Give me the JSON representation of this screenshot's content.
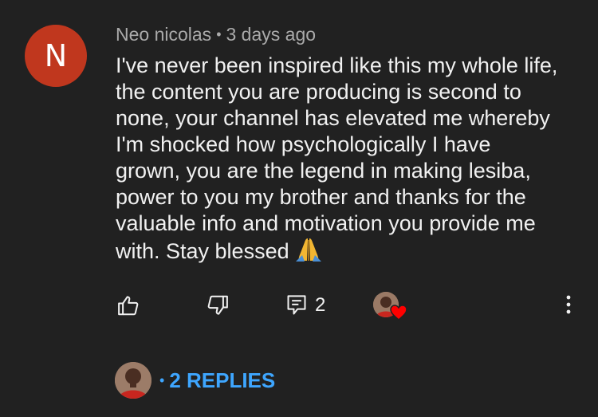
{
  "comment": {
    "avatar_letter": "N",
    "avatar_color": "#c0371e",
    "author": "Neo nicolas",
    "separator": "•",
    "timestamp": "3 days ago",
    "lines": [
      "I've never been inspired like this my whole life,",
      "the content you are producing is second to",
      "none, your channel has elevated me whereby",
      "I'm shocked how psychologically I have",
      "grown, you are the legend in making lesiba,",
      "power to you my brother and thanks for the",
      "valuable info and motivation you provide me",
      "with. Stay blessed"
    ],
    "emoji": "folded-hands-emoji"
  },
  "actions": {
    "like_icon": "thumbs-up-icon",
    "dislike_icon": "thumbs-down-icon",
    "reply_icon": "reply-comment-icon",
    "reply_count": "2",
    "creator_heart_icon": "creator-heart-icon",
    "more_icon": "more-vertical-icon"
  },
  "replies": {
    "separator": "•",
    "label": "2 REPLIES",
    "accent_color": "#3ea6ff"
  },
  "colors": {
    "background": "#212121",
    "text": "#f1f1f1",
    "secondary_text": "#aaaaaa",
    "heart": "#ff0000"
  }
}
